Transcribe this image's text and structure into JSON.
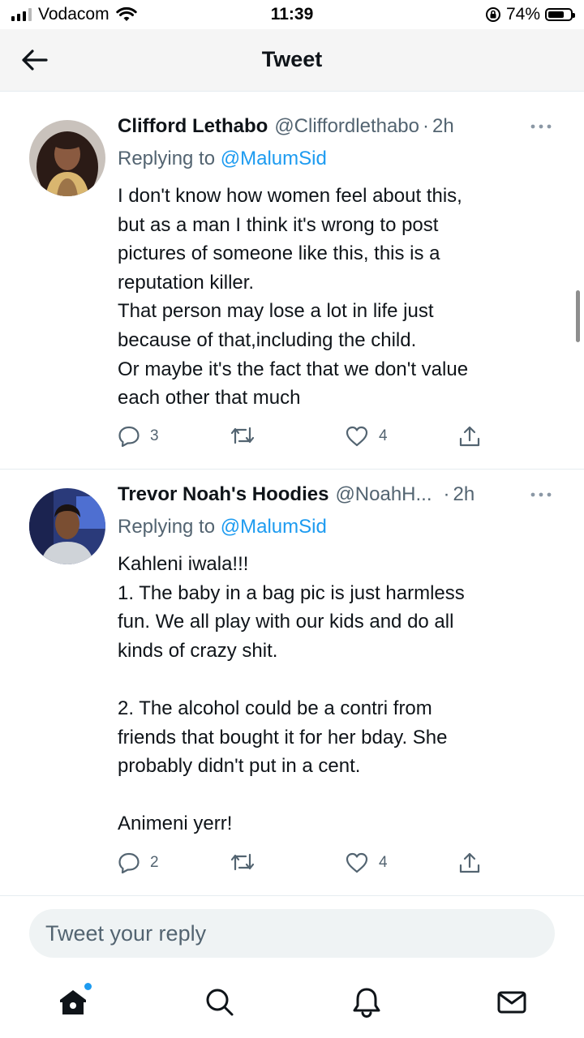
{
  "status_bar": {
    "carrier": "Vodacom",
    "time": "11:39",
    "battery_percent": "74%",
    "battery_level": 0.74,
    "icons": [
      "signal-icon",
      "wifi-icon",
      "orientation-lock-icon",
      "battery-icon"
    ]
  },
  "header": {
    "title": "Tweet",
    "back_icon": "arrow-left-icon"
  },
  "tweets": [
    {
      "name": "Clifford Lethabo",
      "handle": "@Cliffordlethabo",
      "separator": "·",
      "time": "2h",
      "replying_prefix": "Replying to ",
      "replying_to": "@MalumSid",
      "text": "I don't know how women feel about this,\nbut as a man I think it's wrong to post\npictures of someone like this, this is a\nreputation killer.\nThat person may lose a lot in life just\nbecause of that,including the child.\nOr maybe it's the fact that we don't value\neach other that much",
      "replies": "3",
      "retweets": "",
      "likes": "4"
    },
    {
      "name": "Trevor Noah's Hoodies",
      "handle": "@NoahH...",
      "separator": "·",
      "time": "2h",
      "replying_prefix": "Replying to ",
      "replying_to": "@MalumSid",
      "text": "Kahleni iwala!!!\n1. The baby in a bag pic is just harmless\nfun. We all play with our kids and do all\nkinds of crazy shit.\n\n2. The alcohol could be a contri from\nfriends that bought it for her bday. She\nprobably didn't put in a cent.\n\nAnimeni yerr!",
      "replies": "2",
      "retweets": "",
      "likes": "4"
    }
  ],
  "reply_bar": {
    "placeholder": "Tweet your reply"
  },
  "tab_bar": {
    "items": [
      "home-icon",
      "search-icon",
      "notifications-icon",
      "messages-icon"
    ]
  },
  "colors": {
    "accent": "#1d9bf0",
    "text_primary": "#0f1419",
    "text_secondary": "#536471",
    "header_bg": "#f5f5f5"
  }
}
